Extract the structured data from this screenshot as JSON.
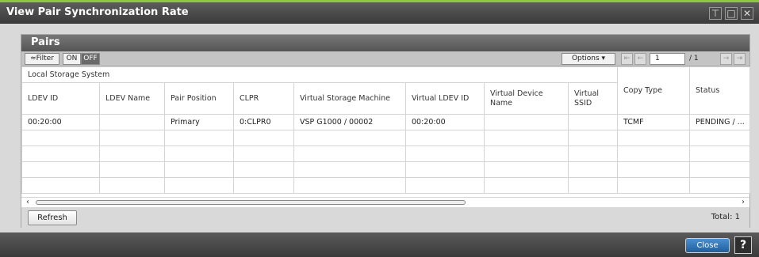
{
  "window": {
    "title": "View Pair Synchronization Rate",
    "controls": [
      {
        "icon": "pin-icon",
        "glyph": "⊤"
      },
      {
        "icon": "maximize-icon",
        "glyph": "□"
      },
      {
        "icon": "close-icon",
        "glyph": "✕"
      }
    ]
  },
  "panel": {
    "title": "Pairs",
    "toolbar": {
      "filter_label": "≈Filter",
      "on_label": "ON",
      "off_label": "OFF",
      "options_label": "Options ▾",
      "page_current": "1",
      "page_total": "/ 1",
      "first_icon": "⇤",
      "prev_icon": "←",
      "next_icon": "→",
      "last_icon": "⇥"
    },
    "table": {
      "group_header": "Local Storage System",
      "columns": [
        "LDEV ID",
        "LDEV Name",
        "Pair Position",
        "CLPR",
        "Virtual Storage Machine",
        "Virtual LDEV ID",
        "Virtual Device Name",
        "Virtual SSID",
        "Copy Type",
        "Status"
      ],
      "rows": [
        [
          "00:20:00",
          "",
          "Primary",
          "0:CLPR0",
          "VSP G1000 / 00002",
          "00:20:00",
          "",
          "",
          "TCMF",
          "PENDING / ..."
        ],
        [
          "",
          "",
          "",
          "",
          "",
          "",
          "",
          "",
          "",
          ""
        ],
        [
          "",
          "",
          "",
          "",
          "",
          "",
          "",
          "",
          "",
          ""
        ],
        [
          "",
          "",
          "",
          "",
          "",
          "",
          "",
          "",
          "",
          ""
        ],
        [
          "",
          "",
          "",
          "",
          "",
          "",
          "",
          "",
          "",
          ""
        ]
      ]
    },
    "scroll": {
      "left": "‹",
      "right": "›"
    },
    "refresh_label": "Refresh",
    "total_label": "Total:  1"
  },
  "footer": {
    "close_label": "Close",
    "help_label": "?"
  },
  "colors": {
    "accent": "#8dc63f",
    "titlebar": "#3a3a3a",
    "close_button": "#1f5f9e"
  }
}
